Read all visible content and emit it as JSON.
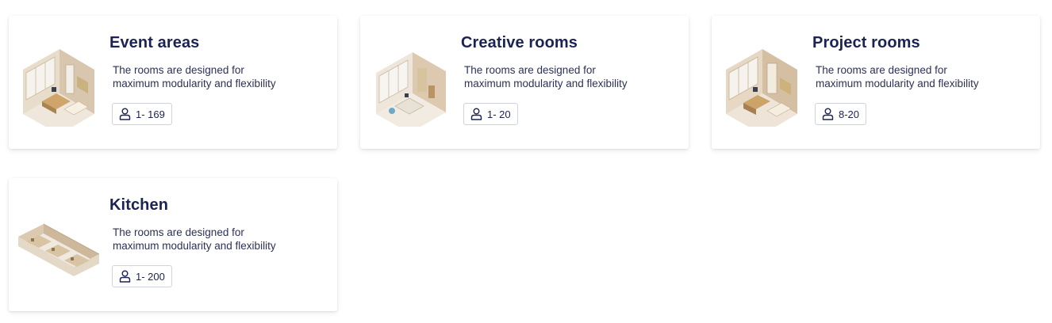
{
  "rooms": [
    {
      "title": "Event areas",
      "description_line1": "The rooms are designed for",
      "description_line2": "maximum modularity and flexibility",
      "capacity": "1- 169",
      "image": "office-room-illustration"
    },
    {
      "title": "Creative rooms",
      "description_line1": "The rooms are designed for",
      "description_line2": "maximum modularity and flexibility",
      "capacity": "1- 20",
      "image": "creative-room-illustration"
    },
    {
      "title": "Project rooms",
      "description_line1": "The rooms are designed for",
      "description_line2": "maximum modularity and flexibility",
      "capacity": "8-20",
      "image": "project-room-illustration"
    },
    {
      "title": "Kitchen",
      "description_line1": "The rooms are designed for",
      "description_line2": "maximum modularity and flexibility",
      "capacity": "1- 200",
      "image": "kitchen-illustration"
    }
  ],
  "icons": {
    "capacity": "person-icon"
  },
  "colors": {
    "title": "#1b2352",
    "text": "#2b3156",
    "border": "#cfd3dd",
    "card_bg": "#ffffff"
  }
}
